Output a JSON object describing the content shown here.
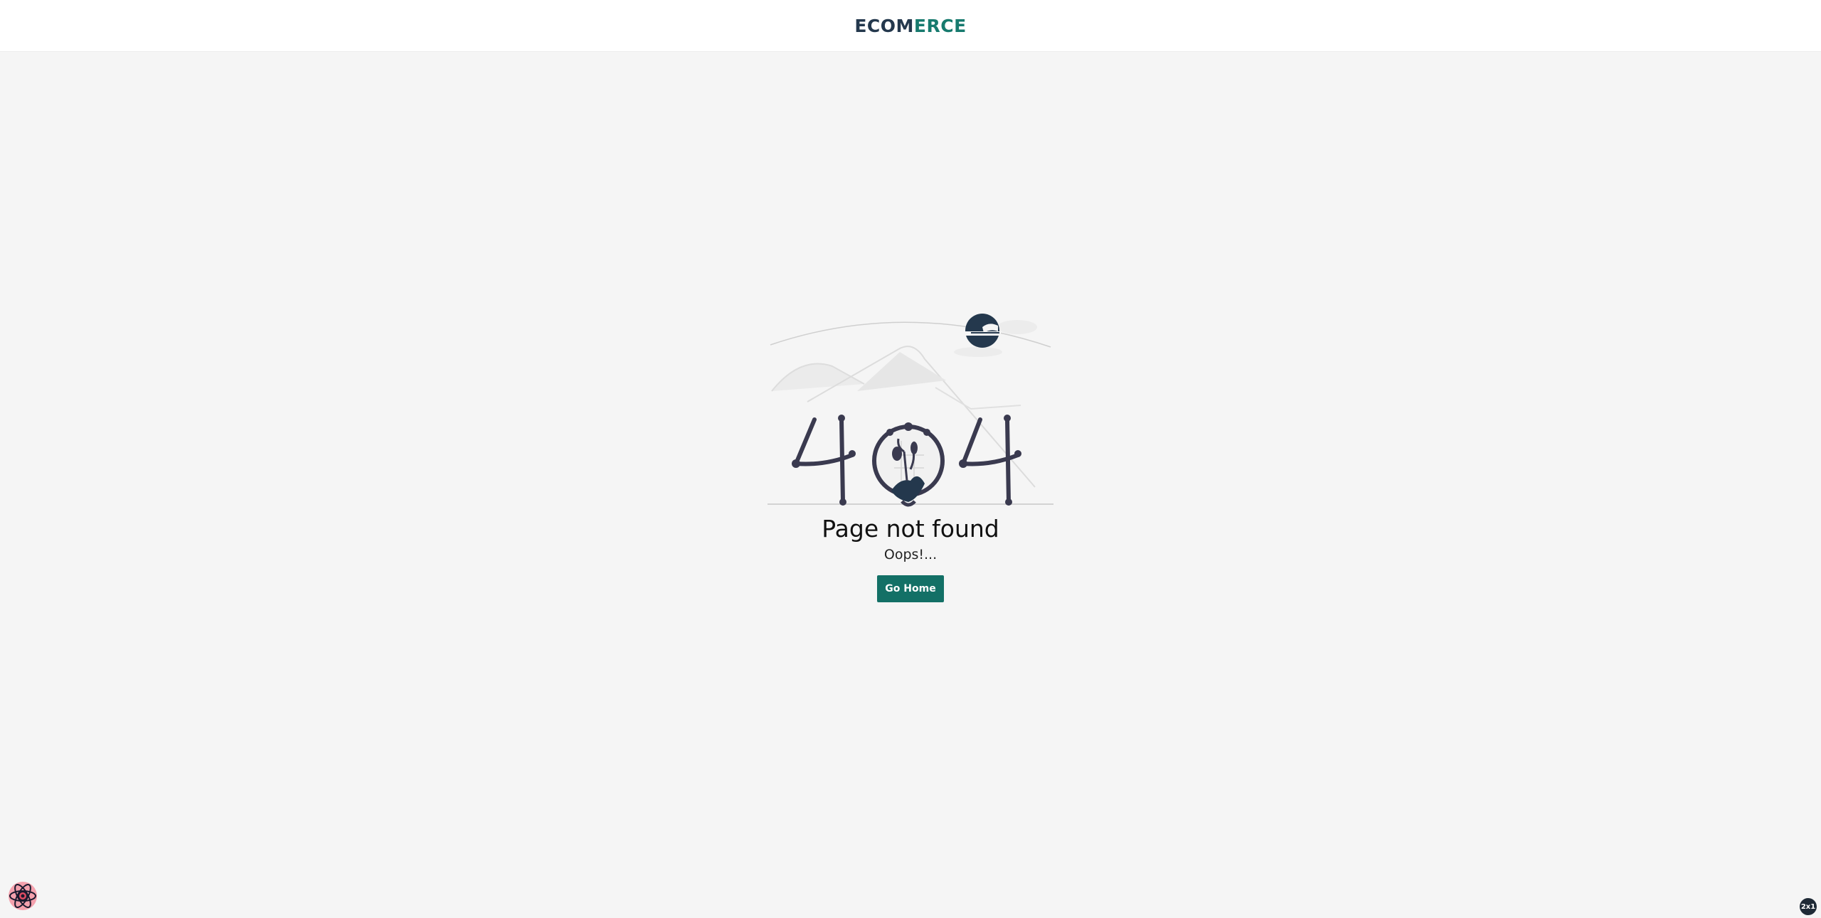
{
  "header": {
    "logo_part1": "ECOM",
    "logo_part2": "ERCE"
  },
  "colors": {
    "brand_dark": "#24384d",
    "brand_accent": "#177a6e",
    "button_bg": "#137066",
    "background": "#f5f5f5"
  },
  "error": {
    "illustration_icon": "404-illustration",
    "title": "Page not found",
    "subtitle": "Oops!...",
    "button_label": "Go Home"
  },
  "overlays": {
    "devtools_icon": "react-devtools-icon",
    "corner_badge": "2x1"
  }
}
